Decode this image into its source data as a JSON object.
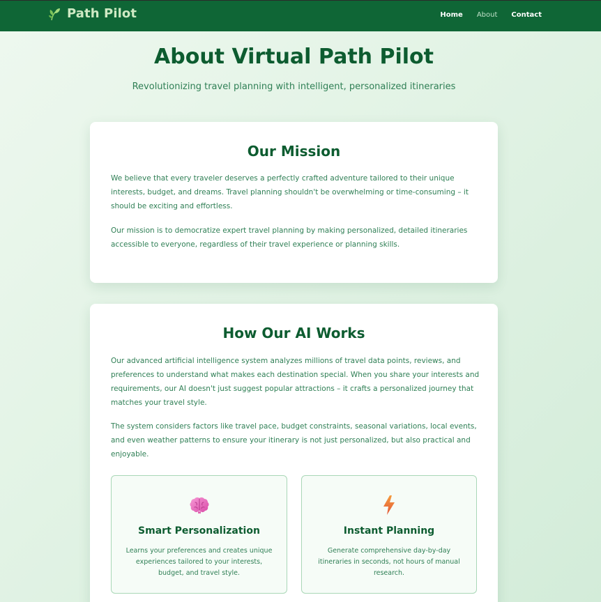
{
  "nav": {
    "brand": "Path Pilot",
    "brand_icon": "leaf-icon",
    "links": [
      {
        "label": "Home"
      },
      {
        "label": "About"
      },
      {
        "label": "Contact"
      }
    ]
  },
  "hero": {
    "title": "About Virtual Path Pilot",
    "subtitle": "Revolutionizing travel planning with intelligent, personalized itineraries"
  },
  "mission": {
    "title": "Our Mission",
    "paragraphs": [
      "We believe that every traveler deserves a perfectly crafted adventure tailored to their unique interests, budget, and dreams. Travel planning shouldn't be overwhelming or time-consuming – it should be exciting and effortless.",
      "Our mission is to democratize expert travel planning by making personalized, detailed itineraries accessible to everyone, regardless of their travel experience or planning skills."
    ]
  },
  "ai": {
    "title": "How Our AI Works",
    "paragraphs": [
      "Our advanced artificial intelligence system analyzes millions of travel data points, reviews, and preferences to understand what makes each destination special. When you share your interests and requirements, our AI doesn't just suggest popular attractions – it crafts a personalized journey that matches your travel style.",
      "The system considers factors like travel pace, budget constraints, seasonal variations, local events, and even weather patterns to ensure your itinerary is not just personalized, but also practical and enjoyable."
    ],
    "features": [
      {
        "icon": "brain-icon",
        "title": "Smart Personalization",
        "text": "Learns your preferences and creates unique experiences tailored to your interests, budget, and travel style."
      },
      {
        "icon": "lightning-icon",
        "title": "Instant Planning",
        "text": "Generate comprehensive day-by-day itineraries in seconds, not hours of manual research."
      }
    ]
  },
  "colors": {
    "nav_bg": "#0f6636",
    "heading": "#0d5c30",
    "body_text": "#2f7f55",
    "feature_border": "#a9d7b7"
  }
}
